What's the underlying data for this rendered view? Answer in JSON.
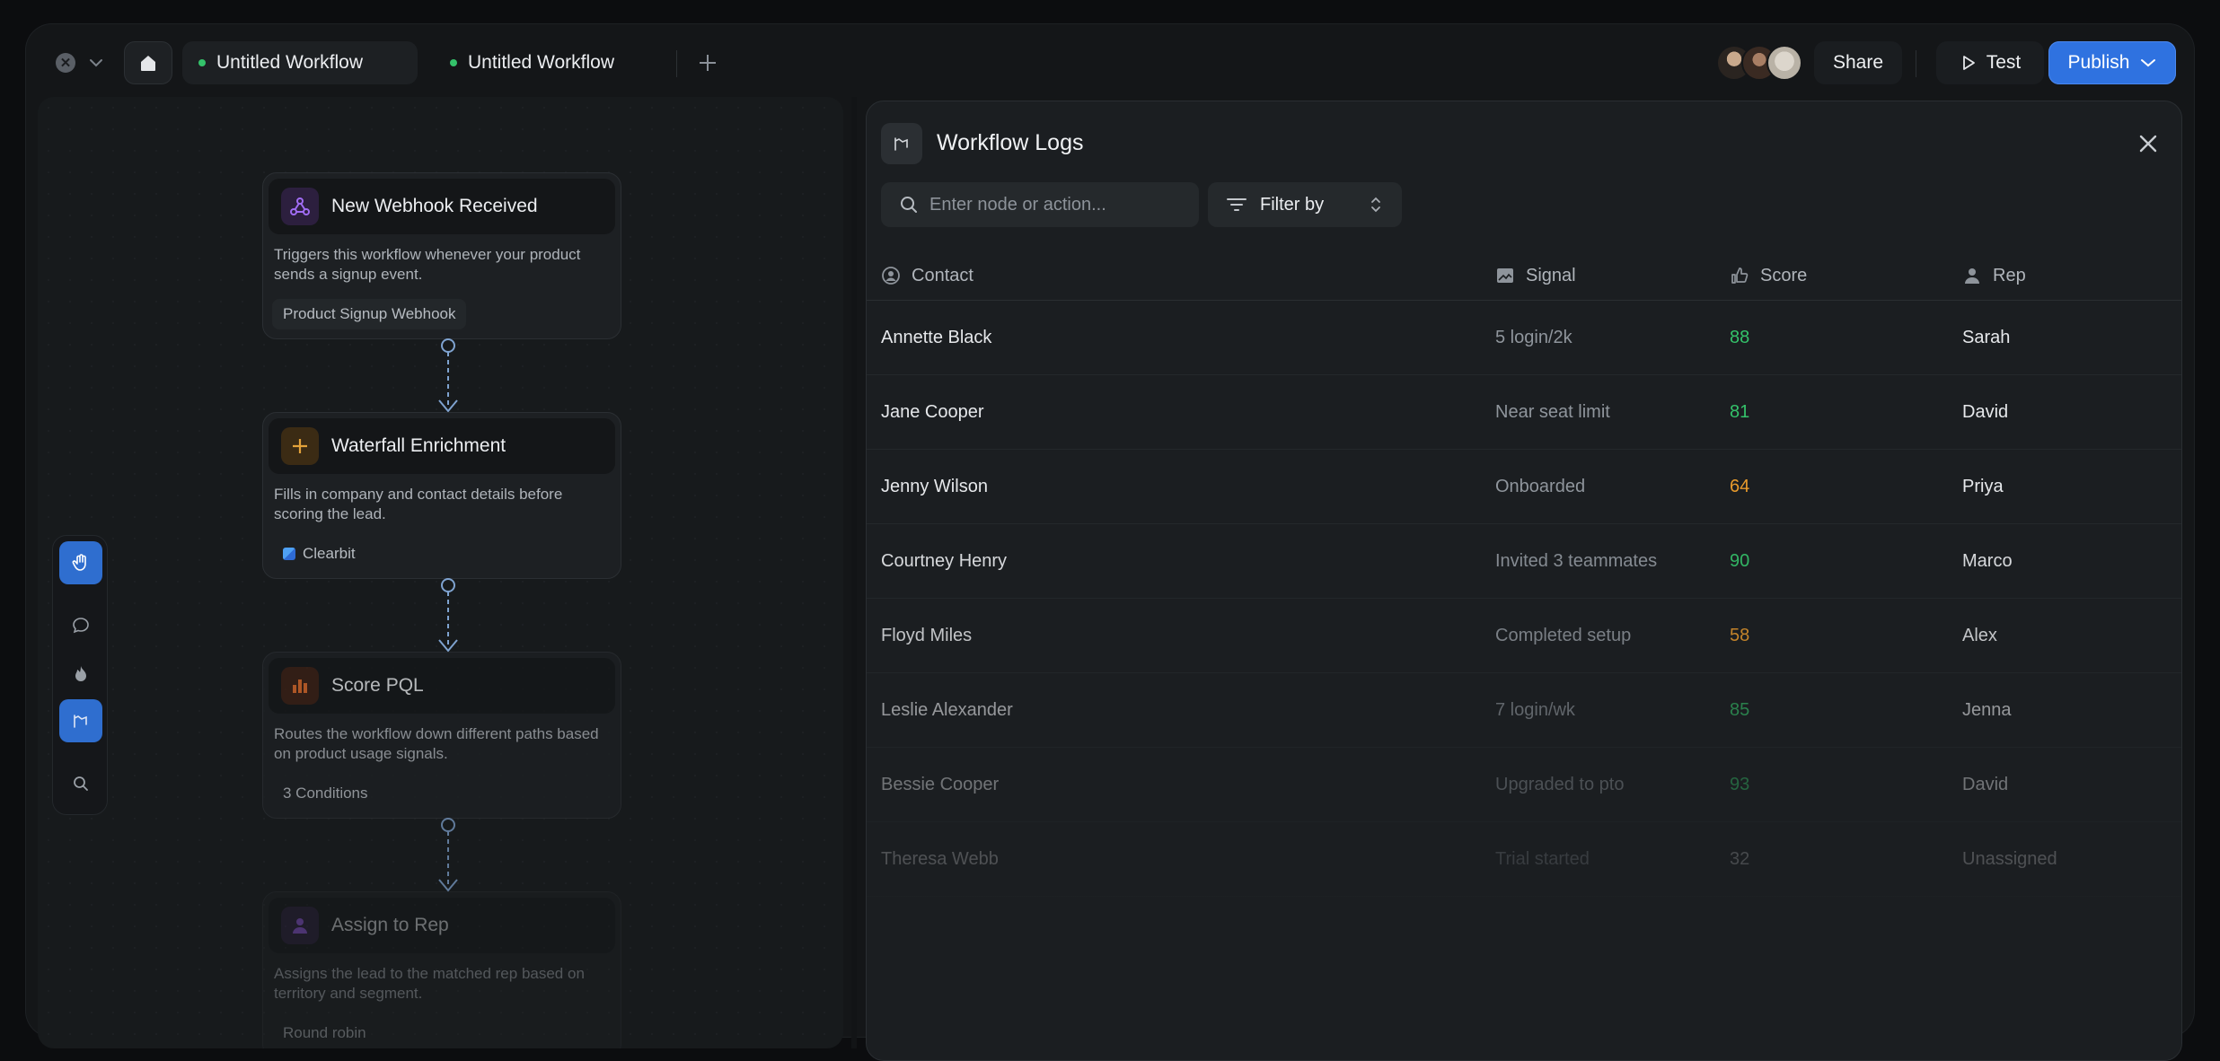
{
  "tabs": [
    {
      "label": "Untitled Workflow",
      "status_color": "#34c26a"
    },
    {
      "label": "Untitled Workflow",
      "status_color": "#34c26a"
    }
  ],
  "header": {
    "share_label": "Share",
    "test_label": "Test",
    "publish_label": "Publish"
  },
  "workflow": {
    "nodes": [
      {
        "title": "New Webhook Received",
        "description": "Triggers this workflow whenever your product sends a signup event.",
        "chip": "Product Signup Webhook",
        "icon": "webhook-icon",
        "accent": "#9b5cf0"
      },
      {
        "title": "Waterfall Enrichment",
        "description": "Fills in company and contact details before scoring the lead.",
        "chip": "Clearbit",
        "icon": "plus-icon",
        "accent": "#e0a23a"
      },
      {
        "title": "Score PQL",
        "description": "Routes the workflow down different paths based on product usage signals.",
        "chip": "3 Conditions",
        "icon": "bar-chart-icon",
        "accent": "#e06a2a"
      },
      {
        "title": "Assign to Rep",
        "description": "Assigns the lead to the matched rep based on territory and segment.",
        "chip": "Round robin",
        "icon": "user-icon",
        "accent": "#9b5cf0"
      }
    ]
  },
  "logs": {
    "title": "Workflow Logs",
    "search_placeholder": "Enter node or action...",
    "filter_label": "Filter by",
    "columns": {
      "contact": "Contact",
      "signal": "Signal",
      "score": "Score",
      "rep": "Rep"
    },
    "rows": [
      {
        "contact": "Annette Black",
        "signal": "5 login/2k",
        "score": "88",
        "rep": "Sarah",
        "score_color": "#34c26a"
      },
      {
        "contact": "Jane Cooper",
        "signal": "Near seat limit",
        "score": "81",
        "rep": "David",
        "score_color": "#34c26a"
      },
      {
        "contact": "Jenny Wilson",
        "signal": "Onboarded",
        "score": "64",
        "rep": "Priya",
        "score_color": "#e89a2c"
      },
      {
        "contact": "Courtney Henry",
        "signal": "Invited 3 teammates",
        "score": "90",
        "rep": "Marco",
        "score_color": "#34c26a"
      },
      {
        "contact": "Floyd Miles",
        "signal": "Completed setup",
        "score": "58",
        "rep": "Alex",
        "score_color": "#e89a2c"
      },
      {
        "contact": "Leslie Alexander",
        "signal": "7 login/wk",
        "score": "85",
        "rep": "Jenna",
        "score_color": "#34c26a"
      },
      {
        "contact": "Bessie Cooper",
        "signal": "Upgraded to pto",
        "score": "93",
        "rep": "David",
        "score_color": "#34c26a"
      },
      {
        "contact": "Theresa Webb",
        "signal": "Trial started",
        "score": "32",
        "rep": "Unassigned",
        "score_color": "#c7c9cc"
      }
    ]
  }
}
